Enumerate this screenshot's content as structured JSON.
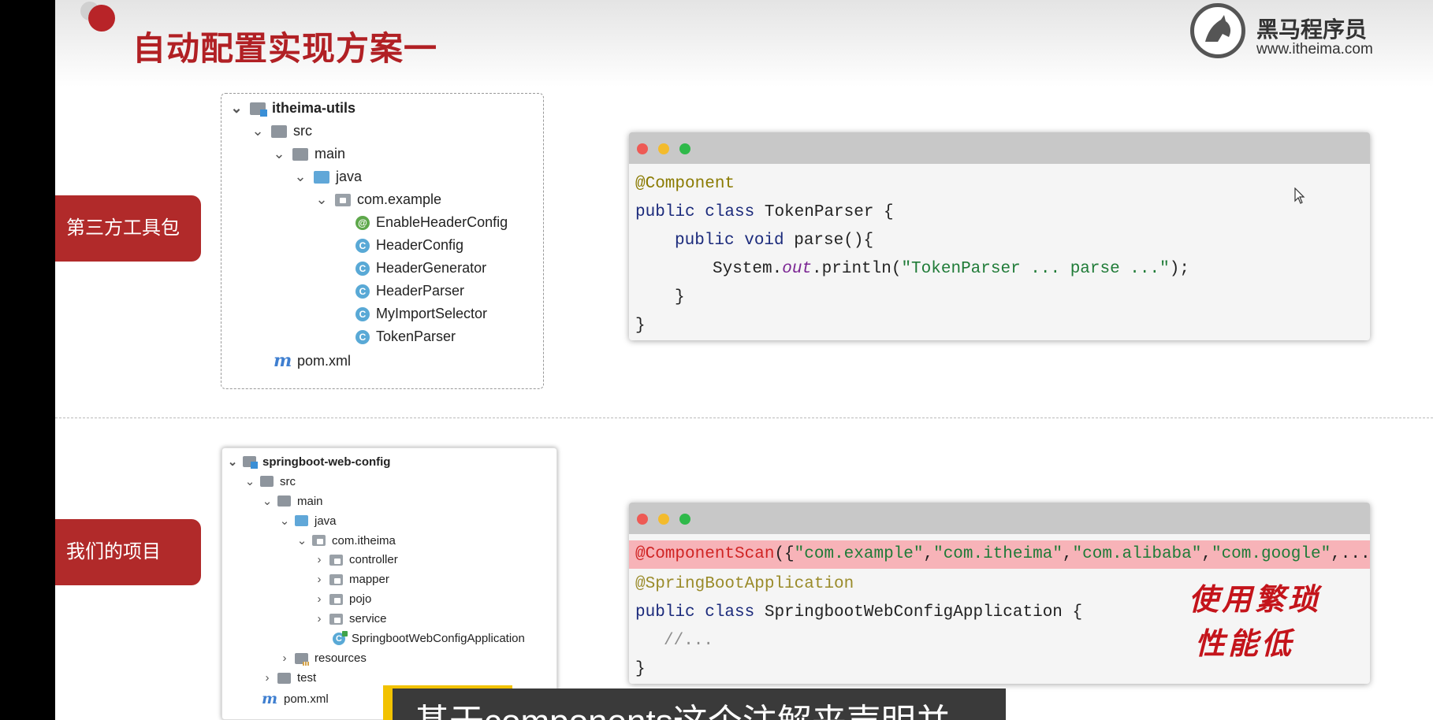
{
  "title": "自动配置实现方案一",
  "logo": {
    "name": "黑马程序员",
    "url": "www.itheima.com"
  },
  "side_labels": {
    "top": "第三方工具包",
    "bottom": "我们的项目"
  },
  "top_tree": {
    "root": "itheima-utils",
    "src": "src",
    "main": "main",
    "java": "java",
    "package": "com.example",
    "classes": [
      "EnableHeaderConfig",
      "HeaderConfig",
      "HeaderGenerator",
      "HeaderParser",
      "MyImportSelector",
      "TokenParser"
    ],
    "pom": "pom.xml"
  },
  "bottom_tree": {
    "root": "springboot-web-config",
    "src": "src",
    "main": "main",
    "java": "java",
    "package": "com.itheima",
    "subpackages": [
      "controller",
      "mapper",
      "pojo",
      "service"
    ],
    "app_class": "SpringbootWebConfigApplication",
    "resources": "resources",
    "test": "test",
    "pom": "pom.xml"
  },
  "code_top": {
    "l1_anno": "@Component",
    "l2_kw": "public class",
    "l2_rest": " TokenParser {",
    "l3_kw": "public void",
    "l3_rest": " parse(){",
    "l4_a": "System.",
    "l4_out": "out",
    "l4_b": ".println(",
    "l4_str": "\"TokenParser ... parse ...\"",
    "l4_end": ");",
    "l5": "}",
    "l6": "}"
  },
  "code_bottom": {
    "l1_anno": "@ComponentScan",
    "l1_open": "({",
    "l1_s1": "\"com.example\"",
    "l1_s2": "\"com.itheima\"",
    "l1_s3": "\"com.alibaba\"",
    "l1_s4": "\"com.google\"",
    "l1_tail": ",...})",
    "comma": ",",
    "l2_anno": "@SpringBootApplication",
    "l3_kw": "public class",
    "l3_rest": " SpringbootWebConfigApplication {",
    "l4_cmt": "//...",
    "l5": "}"
  },
  "handwritten": {
    "line1": "使用繁琐",
    "line2": "性能低"
  },
  "subtitle": "基于components这个注解来声明并",
  "colors": {
    "accent_red": "#b12a2a",
    "title_red": "#b12024",
    "highlight": "#f7b3b8",
    "subtitle_chip": "#f2c200"
  }
}
